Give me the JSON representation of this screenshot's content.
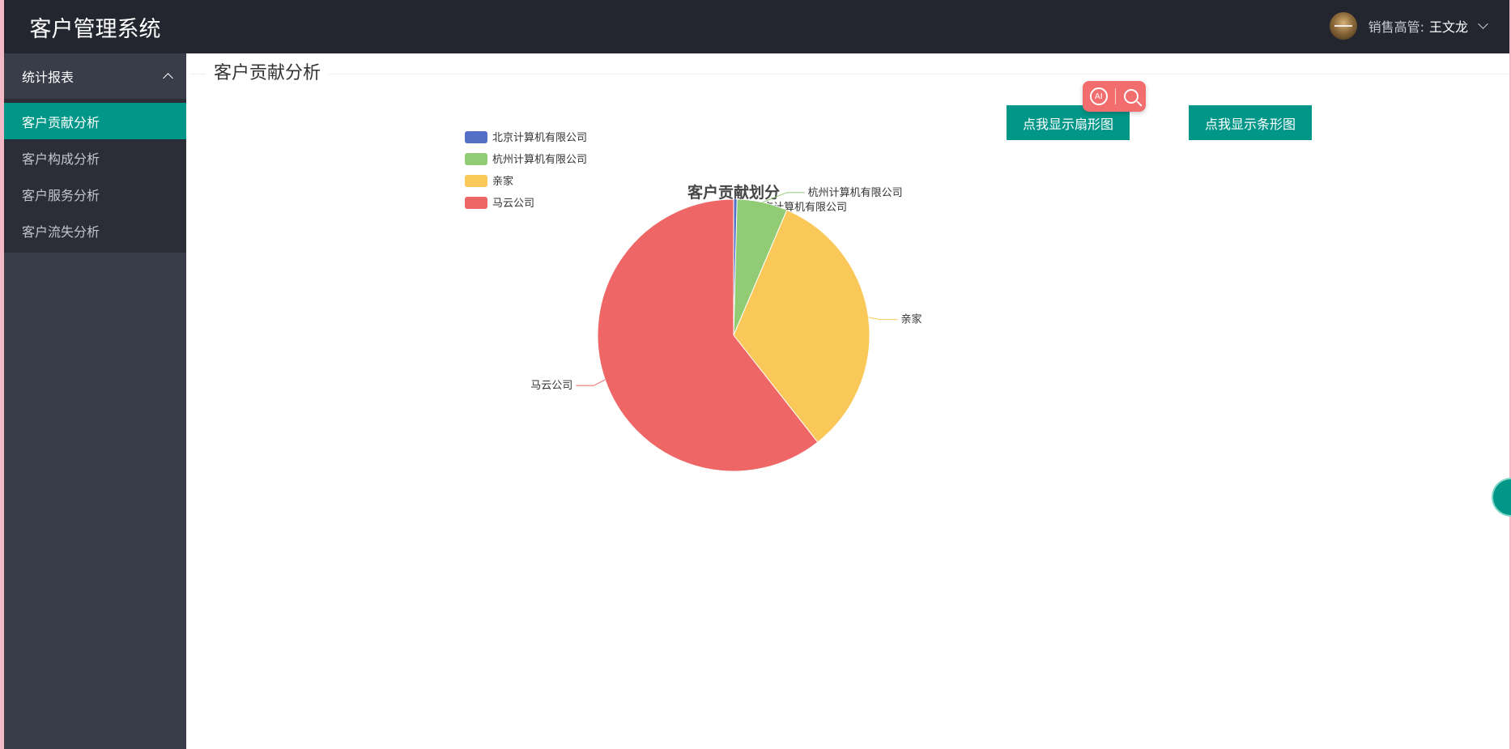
{
  "app": {
    "title": "客户管理系统"
  },
  "header": {
    "user_role_label": "销售高管:",
    "user_name": "王文龙"
  },
  "sidebar": {
    "group_label": "统计报表",
    "items": [
      {
        "label": "客户贡献分析",
        "active": true
      },
      {
        "label": "客户构成分析",
        "active": false
      },
      {
        "label": "客户服务分析",
        "active": false
      },
      {
        "label": "客户流失分析",
        "active": false
      }
    ]
  },
  "main": {
    "title": "客户贡献分析",
    "buttons": {
      "show_pie": "点我显示扇形图",
      "show_bar": "点我显示条形图"
    },
    "ai_tool": {
      "label": "AI",
      "icon_ai": "ai-circle-icon",
      "icon_search": "search-icon"
    }
  },
  "chart_data": {
    "type": "pie",
    "title": "客户贡献划分",
    "legend_position": "top-left",
    "slices": [
      {
        "name": "北京计算机有限公司",
        "value": 0.4,
        "color": "#5470c6"
      },
      {
        "name": "杭州计算机有限公司",
        "value": 6,
        "color": "#91cc75"
      },
      {
        "name": "亲家",
        "value": 33,
        "color": "#fac858"
      },
      {
        "name": "马云公司",
        "value": 60.6,
        "color": "#ee6666"
      }
    ]
  },
  "colors": {
    "header_bg": "#23262e",
    "sidebar_bg": "#393d49",
    "accent": "#009688"
  }
}
